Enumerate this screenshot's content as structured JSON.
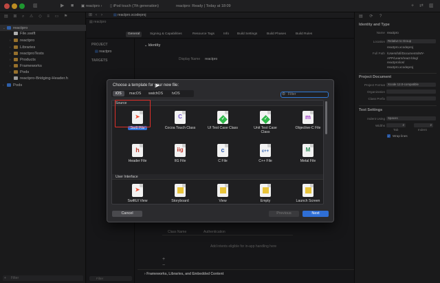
{
  "window": {
    "scheme": "reactpro",
    "device": "iPod touch (7th generation)",
    "status": "reactpro: Ready",
    "status_time": "Today at 18:09"
  },
  "tab": {
    "label": "reactpro.xcodeproj"
  },
  "navigator": {
    "items": [
      {
        "label": "reactpro",
        "kind": "project",
        "indent": 0
      },
      {
        "label": "File.swift",
        "kind": "swift",
        "indent": 1
      },
      {
        "label": "reactpro",
        "kind": "folder",
        "indent": 1
      },
      {
        "label": "Libraries",
        "kind": "folder",
        "indent": 1
      },
      {
        "label": "reactproTests",
        "kind": "folder",
        "indent": 1
      },
      {
        "label": "Products",
        "kind": "folder",
        "indent": 1
      },
      {
        "label": "Frameworks",
        "kind": "folder",
        "indent": 1
      },
      {
        "label": "Pods",
        "kind": "folder",
        "indent": 1
      },
      {
        "label": "reactpro-Bridging-Header.h",
        "kind": "header",
        "indent": 1
      },
      {
        "label": "Pods",
        "kind": "project",
        "indent": 0
      }
    ],
    "filter_placeholder": "Filter"
  },
  "editor": {
    "breadcrumb_project": "reactpro",
    "tabs": [
      "General",
      "Signing & Capabilities",
      "Resource Tags",
      "Info",
      "Build Settings",
      "Build Phases",
      "Build Rules"
    ],
    "project_header": "PROJECT",
    "project_item": "reactpro",
    "targets_header": "TARGETS",
    "identity_header": "Identity",
    "display_name_label": "Display Name",
    "display_name_value": "reactpro",
    "class_name_col": "Class Name",
    "auth_col": "Authentication",
    "add_intents_hint": "Add intents eligible for in-app handling here",
    "frameworks_header": "Frameworks, Libraries, and Embedded Content",
    "bottom_filter_placeholder": "Filter"
  },
  "inspector": {
    "identity_header": "Identity and Type",
    "name_label": "Name",
    "name_value": "reactpro",
    "location_label": "Location",
    "location_value": "Relative to Group",
    "location_file": "reactpro.xcodeproj",
    "fullpath_label": "Full Path",
    "fullpath_lines": [
      "/Users/lofi/Documents/MY-",
      "APP/Learn/react-blog/",
      "reactpro/ios/",
      "reactpro.xcodeproj"
    ],
    "project_doc_header": "Project Document",
    "project_format_label": "Project Format",
    "project_format_value": "Xcode 12.0-compatible",
    "organization_label": "Organization",
    "class_prefix_label": "Class Prefix",
    "text_settings_header": "Text Settings",
    "indent_using_label": "Indent Using",
    "indent_using_value": "Spaces",
    "widths_label": "Widths",
    "tab_value": "2",
    "indent_value": "2",
    "tab_label": "Tab",
    "indent_label": "Indent",
    "wrap_lines_label": "Wrap lines"
  },
  "sheet": {
    "title": "Choose a template for your new file:",
    "platforms": [
      "iOS",
      "macOS",
      "watchOS",
      "tvOS"
    ],
    "selected_platform": "iOS",
    "filter_placeholder": "Filter",
    "section_source": "Source",
    "section_ui": "User Interface",
    "templates_row1": [
      {
        "label": "Swift File",
        "icon": "swift-icon",
        "selected": true
      },
      {
        "label": "Cocoa Touch Class",
        "icon": "cocoa-touch-class-icon"
      },
      {
        "label": "UI Test Case Class",
        "icon": "ui-test-case-icon"
      },
      {
        "label": "Unit Test Case Class",
        "icon": "unit-test-case-icon"
      },
      {
        "label": "Objective-C File",
        "icon": "objective-c-icon"
      }
    ],
    "templates_row2": [
      {
        "label": "Header File",
        "icon": "header-file-icon"
      },
      {
        "label": "IIG File",
        "icon": "iig-file-icon"
      },
      {
        "label": "C File",
        "icon": "c-file-icon"
      },
      {
        "label": "C++ File",
        "icon": "cpp-file-icon"
      },
      {
        "label": "Metal File",
        "icon": "metal-file-icon"
      }
    ],
    "templates_row3": [
      {
        "label": "SwiftUI View",
        "icon": "swiftui-view-icon"
      },
      {
        "label": "Storyboard",
        "icon": "storyboard-icon"
      },
      {
        "label": "View",
        "icon": "view-icon"
      },
      {
        "label": "Empty",
        "icon": "empty-file-icon"
      },
      {
        "label": "Launch Screen",
        "icon": "launch-screen-icon"
      }
    ],
    "cancel_label": "Cancel",
    "previous_label": "Previous",
    "next_label": "Next"
  },
  "colors": {
    "accent": "#2f6fd6",
    "highlight": "#e0302a",
    "swift": "#f05138",
    "check": "#2fb84a",
    "objc": "#a03ac8"
  }
}
